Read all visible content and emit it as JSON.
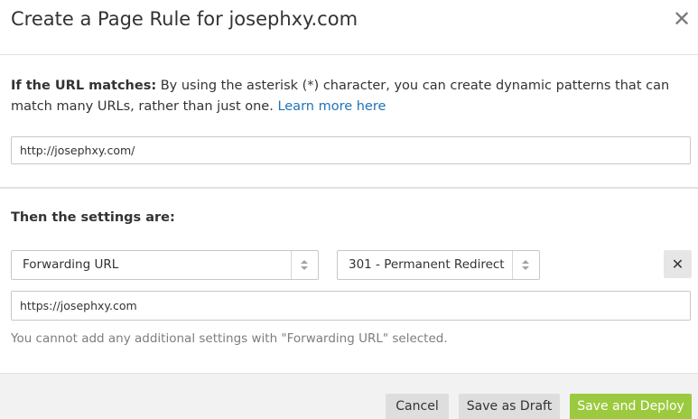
{
  "header": {
    "title": "Create a Page Rule for josephxy.com",
    "close_icon": "close-icon"
  },
  "url_section": {
    "label": "If the URL matches:",
    "description": " By using the asterisk (*) character, you can create dynamic patterns that can match many URLs, rather than just one. ",
    "learn_more": "Learn more here",
    "url_value": "http://josephxy.com/"
  },
  "settings_section": {
    "label": "Then the settings are:",
    "setting_select": "Forwarding URL",
    "status_select": "301 - Permanent Redirect",
    "remove_icon": "close-x-icon",
    "destination_value": "https://josephxy.com",
    "note": "You cannot add any additional settings with \"Forwarding URL\" selected."
  },
  "footer": {
    "cancel_label": "Cancel",
    "draft_label": "Save as Draft",
    "deploy_label": "Save and Deploy"
  },
  "colors": {
    "link": "#1f73b7",
    "deploy_button": "#9bca3e",
    "secondary_button": "#dedede"
  }
}
